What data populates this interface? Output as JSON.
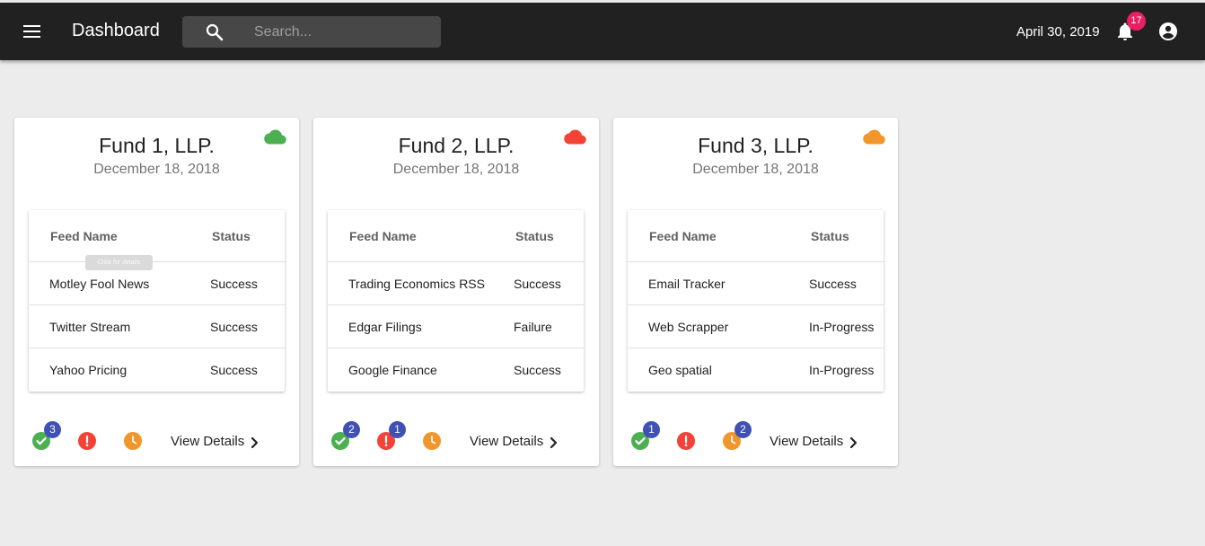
{
  "header": {
    "title": "Dashboard",
    "search_placeholder": "Search...",
    "date": "April 30, 2019",
    "notification_count": "17",
    "menu_icon": "menu-icon",
    "search_icon": "search-icon",
    "bell_icon": "bell-icon",
    "account_icon": "account-circle-icon"
  },
  "colors": {
    "topbar": "#212121",
    "success": "#4caf50",
    "failure": "#f44336",
    "in_progress": "#f0962a",
    "count_badge": "#3f51b5",
    "notification_badge": "#e91e63"
  },
  "table_headers": {
    "name": "Feed Name",
    "status": "Status"
  },
  "footer": {
    "view_details_label": "View Details"
  },
  "tooltip": "Click for details",
  "funds": [
    {
      "name": "Fund 1, LLP.",
      "date": "December 18, 2018",
      "cloud_status": "success",
      "cloud_color": "#4caf50",
      "rows": [
        {
          "name": "Motley Fool News",
          "status": "Success"
        },
        {
          "name": "Twitter Stream",
          "status": "Success"
        },
        {
          "name": "Yahoo Pricing",
          "status": "Success"
        }
      ],
      "counts": {
        "success": "3",
        "failure": "",
        "in_progress": ""
      }
    },
    {
      "name": "Fund 2, LLP.",
      "date": "December 18, 2018",
      "cloud_status": "failure",
      "cloud_color": "#f44336",
      "rows": [
        {
          "name": "Trading Economics RSS",
          "status": "Success"
        },
        {
          "name": "Edgar Filings",
          "status": "Failure"
        },
        {
          "name": "Google Finance",
          "status": "Success"
        }
      ],
      "counts": {
        "success": "2",
        "failure": "1",
        "in_progress": ""
      }
    },
    {
      "name": "Fund 3, LLP.",
      "date": "December 18, 2018",
      "cloud_status": "in-progress",
      "cloud_color": "#f0962a",
      "rows": [
        {
          "name": "Email Tracker",
          "status": "Success"
        },
        {
          "name": "Web Scrapper",
          "status": "In-Progress"
        },
        {
          "name": "Geo spatial",
          "status": "In-Progress"
        }
      ],
      "counts": {
        "success": "1",
        "failure": "",
        "in_progress": "2"
      }
    }
  ]
}
